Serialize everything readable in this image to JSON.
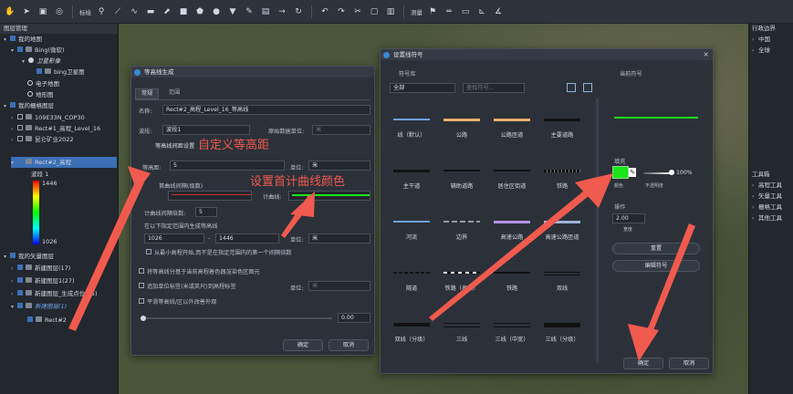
{
  "toolbar": {
    "label_mark": "标绘",
    "label_measure": "测量"
  },
  "left_panel": {
    "title": "图层管理",
    "my_maps": "我的地图",
    "bing": "Bing(微软)",
    "sat_image": "卫星影像",
    "bing_sat": "bing卫星图",
    "e_map": "电子地图",
    "terrain_map": "地形图",
    "raster_layers": "我的栅格图层",
    "r1": "109E33N_COP30",
    "r2": "Rect#1_高程_Level_16",
    "r3": "昆仑矿业2022",
    "r4": "Rect#2_高程",
    "band": "波段 1",
    "band_max": "1446",
    "band_min": "1026",
    "vector_layers": "我的矢量图层",
    "v1": "新建图层(17)",
    "v2": "新建图层1(27)",
    "v3": "新建图层_生成点位(15)",
    "v4": "新建图层(1)",
    "v5": "Rect#2"
  },
  "right_panel": {
    "title": "行政边界",
    "china": "中国",
    "world": "全球",
    "toolbox": "工具箱",
    "t1": "高程工具",
    "t2": "矢量工具",
    "t3": "栅格工具",
    "t4": "其他工具"
  },
  "contour_dialog": {
    "title": "等高线生成",
    "tab_general": "常规",
    "tab_range": "范围",
    "name_label": "名称:",
    "name_value": "Rect#2_高程_Level_16_等高线",
    "band_label": "波段:",
    "band_value": "波段1",
    "unit_label": "原始数据单位:",
    "unit_value": "米",
    "interval_section": "等高线间距设置",
    "interval_label": "等高距:",
    "interval_value": "5",
    "unit2_label": "单位:",
    "unit2_value": "米",
    "index_count_label": "首曲线间隔(级数)",
    "index_color_label": "计曲线:",
    "index_interval_label": "计曲线间隔倍数:",
    "index_interval_value": "5",
    "range_label": "在以下指定范围内生成等高线",
    "range_min": "1026",
    "range_max": "1446",
    "unit3_label": "单位:",
    "unit3_value": "米",
    "opt1": "从最小高程开始,而不是在指定范围内的第一个间隔倍数",
    "opt2": "将等高线分基于当前高程着色器渲染色区图元",
    "opt3": "追加单位标签(米或英尺)到高程标签",
    "unit4_label": "单位:",
    "unit4_value": "米",
    "opt4": "平滑等高线/区以外改善外观",
    "smooth_value": "0.00",
    "ok": "确定",
    "cancel": "取消"
  },
  "symbol_dialog": {
    "title": "设置线符号",
    "lib_label": "符号库",
    "lib_value": "全部",
    "search_placeholder": "查找符号...",
    "current_label": "当前符号",
    "symbols": [
      "线（默认）",
      "公路",
      "公路匝道",
      "主要道路",
      "主干道",
      "辅助道路",
      "居住区街道",
      "铁路",
      "河流",
      "边界",
      "高速公路",
      "高速公路匝道",
      "隧道",
      "铁路（名站）",
      "铁路",
      "双线",
      "双线（分级）",
      "三线",
      "三线（中宽）",
      "三线（分级）"
    ],
    "fill_label": "填充",
    "color_label": "颜色",
    "opacity_value": "100%",
    "opacity_label": "不透明度",
    "width_label": "宽度",
    "width_value": "2.00",
    "width_unit": "宽度",
    "action_label": "操作",
    "reset": "重置",
    "edit_symbol": "编辑符号",
    "ok": "确定",
    "cancel": "取消"
  },
  "annotations": {
    "a1": "自定义等高距",
    "a2": "设置首计曲线颜色"
  },
  "colors": {
    "accent": "#3b6fb6",
    "annotation": "#f05a4f",
    "green": "#19e619"
  }
}
